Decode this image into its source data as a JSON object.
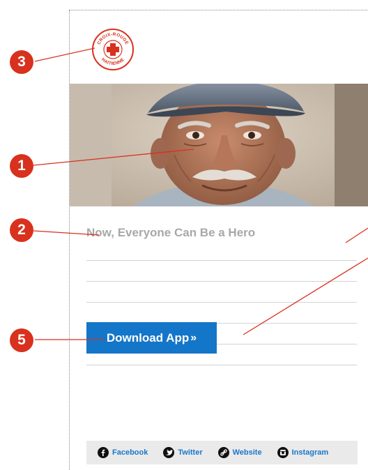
{
  "logo": {
    "top_text": "CROIX-ROUGE",
    "bottom_text": "HAITIENNE",
    "brand_color": "#d8311e"
  },
  "hero": {
    "icon": "portrait-photo"
  },
  "email": {
    "headline": "Now, Everyone Can Be a Hero",
    "cta_label": "Download App",
    "cta_suffix": "»",
    "cta_color": "#1476c8"
  },
  "social": {
    "items": [
      {
        "label": "Facebook",
        "icon": "facebook-icon"
      },
      {
        "label": "Twitter",
        "icon": "twitter-icon"
      },
      {
        "label": "Website",
        "icon": "link-icon"
      },
      {
        "label": "Instagram",
        "icon": "instagram-icon"
      }
    ],
    "link_color": "#1a77c9"
  },
  "annotations": {
    "markers": [
      "1",
      "2",
      "3",
      "5"
    ],
    "marker_color": "#d8311e"
  }
}
